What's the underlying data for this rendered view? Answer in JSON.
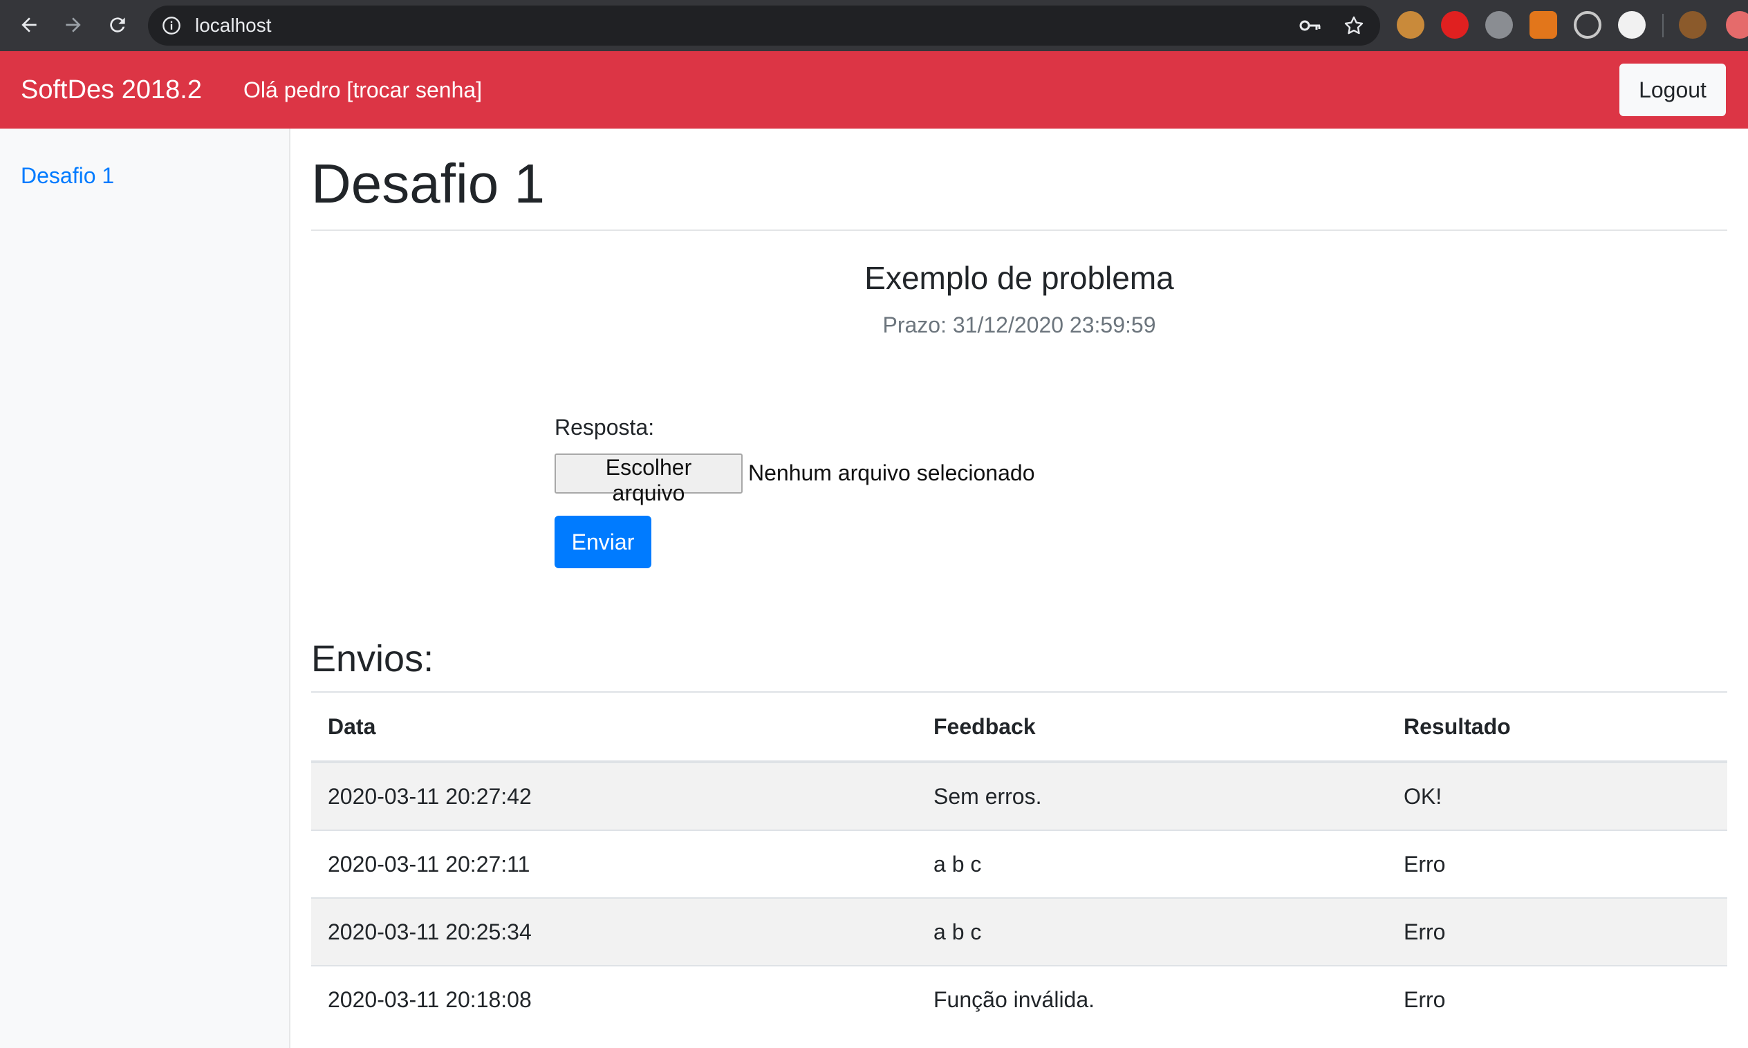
{
  "browser": {
    "url": "localhost"
  },
  "navbar": {
    "brand": "SoftDes 2018.2",
    "greeting": "Olá pedro",
    "change_password": "[trocar senha]",
    "logout_label": "Logout",
    "color": "#dc3545"
  },
  "sidebar": {
    "items": [
      {
        "label": "Desafio 1"
      }
    ]
  },
  "main": {
    "title": "Desafio 1",
    "problem_title": "Exemplo de problema",
    "deadline": "Prazo: 31/12/2020 23:59:59",
    "answer_label": "Resposta:",
    "file_button": "Escolher arquivo",
    "file_status": "Nenhum arquivo selecionado",
    "submit_label": "Enviar",
    "submissions_title": "Envios:",
    "table": {
      "headers": [
        "Data",
        "Feedback",
        "Resultado"
      ],
      "rows": [
        [
          "2020-03-11 20:27:42",
          "Sem erros.",
          "OK!"
        ],
        [
          "2020-03-11 20:27:11",
          "a b c",
          "Erro"
        ],
        [
          "2020-03-11 20:25:34",
          "a b c",
          "Erro"
        ],
        [
          "2020-03-11 20:18:08",
          "Função inválida.",
          "Erro"
        ]
      ]
    }
  }
}
